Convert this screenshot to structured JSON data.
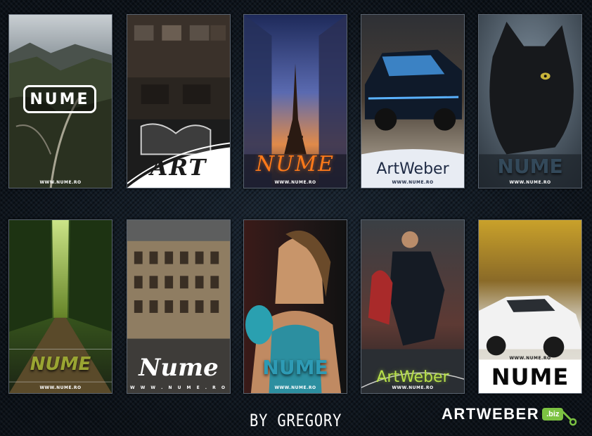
{
  "cards": [
    {
      "logo": "NUME",
      "url": "WWW.NUME.RO"
    },
    {
      "logo": "ART",
      "url": ""
    },
    {
      "logo": "NUME",
      "url": "WWW.NUME.RO"
    },
    {
      "logo": "ArtWeber",
      "url": "WWW.NUME.RO"
    },
    {
      "logo": "NUME",
      "url": "WWW.NUME.RO"
    },
    {
      "logo": "NUME",
      "url": "WWW.NUME.RO"
    },
    {
      "logo": "Nume",
      "url": "W W W . N U M E . R O"
    },
    {
      "logo": "NUME",
      "url": "WWW.NUME.RO"
    },
    {
      "logo": "ArtWeber",
      "url": "WWW.NUME.RO"
    },
    {
      "logo": "NUME",
      "url": "WWW.NUME.RO"
    }
  ],
  "credit": "BY GREGORY",
  "brand": {
    "name": "ARTWEBER",
    "tld": ".biz"
  }
}
